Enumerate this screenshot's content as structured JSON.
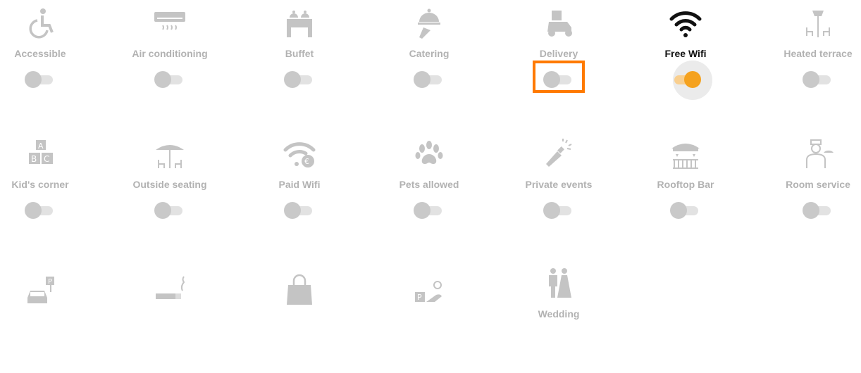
{
  "accent_color": "#f5a21f",
  "highlight_color": "#ff7a00",
  "features": [
    {
      "label": "Accessible",
      "icon": "wheelchair-icon",
      "enabled": false
    },
    {
      "label": "Air conditioning",
      "icon": "air-conditioner-icon",
      "enabled": false
    },
    {
      "label": "Buffet",
      "icon": "buffet-icon",
      "enabled": false
    },
    {
      "label": "Catering",
      "icon": "catering-cloche-icon",
      "enabled": false
    },
    {
      "label": "Delivery",
      "icon": "delivery-scooter-icon",
      "enabled": false
    },
    {
      "label": "Free Wifi",
      "icon": "wifi-icon",
      "enabled": true
    },
    {
      "label": "Heated terrace",
      "icon": "heated-terrace-icon",
      "enabled": false
    },
    {
      "label": "Kid's corner",
      "icon": "toy-blocks-icon",
      "enabled": false
    },
    {
      "label": "Outside seating",
      "icon": "parasol-table-icon",
      "enabled": false
    },
    {
      "label": "Paid Wifi",
      "icon": "paid-wifi-icon",
      "enabled": false
    },
    {
      "label": "Pets allowed",
      "icon": "paw-icon",
      "enabled": false
    },
    {
      "label": "Private events",
      "icon": "champagne-icon",
      "enabled": false
    },
    {
      "label": "Rooftop Bar",
      "icon": "rooftop-bar-icon",
      "enabled": false
    },
    {
      "label": "Room service",
      "icon": "room-service-icon",
      "enabled": false
    },
    {
      "label": "",
      "icon": "car-parking-icon",
      "enabled": false
    },
    {
      "label": "",
      "icon": "cigarette-icon",
      "enabled": false
    },
    {
      "label": "",
      "icon": "shopping-bag-icon",
      "enabled": false
    },
    {
      "label": "",
      "icon": "valet-parking-icon",
      "enabled": false
    },
    {
      "label": "Wedding",
      "icon": "wedding-couple-icon",
      "enabled": false
    }
  ]
}
